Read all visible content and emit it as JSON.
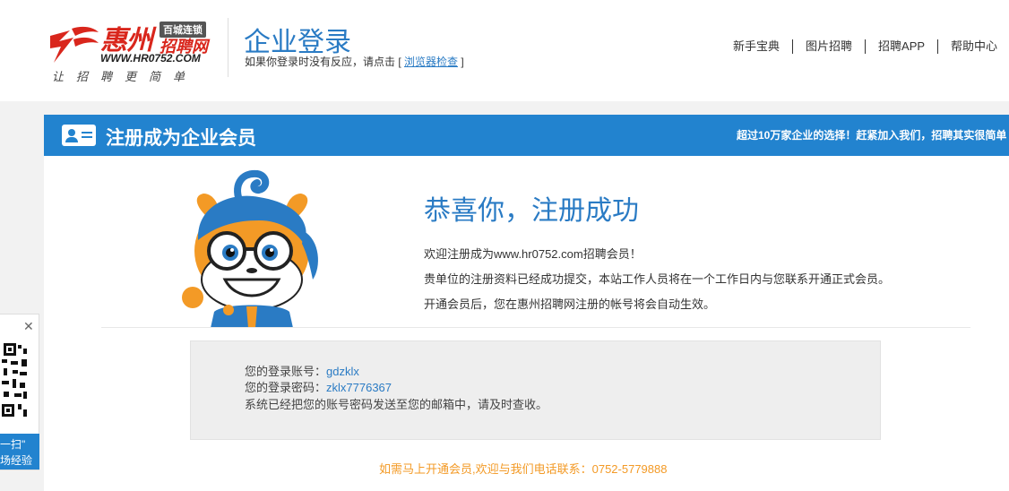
{
  "header": {
    "logo": {
      "brand": "惠州",
      "badge": "百城连锁",
      "brand_sub": "招聘网",
      "url": "WWW.HR0752.COM",
      "slogan": "让招聘更简单"
    },
    "title": "企业登录",
    "subtitle_prefix": "如果你登录时没有反应，请点击 [ ",
    "subtitle_link": "浏览器检查",
    "subtitle_suffix": " ]",
    "nav": [
      "新手宝典",
      "图片招聘",
      "招聘APP",
      "帮助中心"
    ]
  },
  "banner": {
    "title": "注册成为企业会员",
    "promo": "超过10万家企业的选择！赶紧加入我们，招聘其实很简单"
  },
  "success": {
    "title": "恭喜你，注册成功",
    "line1": "欢迎注册成为www.hr0752.com招聘会员！",
    "line2": "贵单位的注册资料已经成功提交，本站工作人员将在一个工作日内与您联系开通正式会员。",
    "line3": "开通会员后，您在惠州招聘网注册的帐号将会自动生效。"
  },
  "account": {
    "username_label": "您的登录账号：",
    "username": "gdzklx",
    "password_label": "您的登录密码：",
    "password": "zklx7776367",
    "note": "系统已经把您的账号密码发送至您的邮箱中，请及时查收。"
  },
  "contact": "如需马上开通会员,欢迎与我们电话联系：0752-5779888",
  "qr_widget": {
    "close": "✕",
    "label_line1": "扫一扫\"",
    "label_line2": "现场经验"
  },
  "colors": {
    "primary": "#2283cf",
    "title_blue": "#2a7bc4",
    "brand_red": "#d9261c",
    "contact_orange": "#f39a26"
  }
}
